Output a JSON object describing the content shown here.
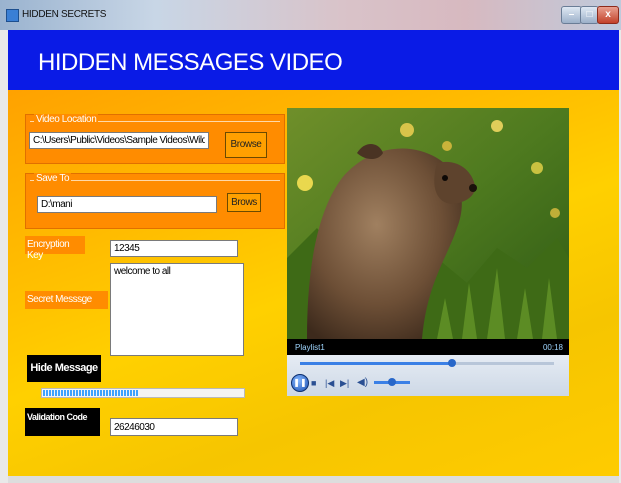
{
  "window": {
    "title": "HIDDEN SECRETS",
    "min_label": "–",
    "max_label": "□",
    "close_label": "x"
  },
  "header": {
    "title": "HIDDEN MESSAGES VIDEO"
  },
  "video_location": {
    "legend": "Video Location",
    "value": "C:\\Users\\Public\\Videos\\Sample Videos\\Wildlife",
    "browse_label": "Browse"
  },
  "save_to": {
    "legend": "Save To",
    "value": "D:\\mani",
    "browse_label": "Brows"
  },
  "encryption": {
    "label": "Encryption Key",
    "value": "12345"
  },
  "secret": {
    "label": "Secret Messsge",
    "value": "welcome to all"
  },
  "hide_button": {
    "label": "Hide Message"
  },
  "progress": {
    "fraction": 0.48
  },
  "validation": {
    "label": "Validation Code",
    "value": "26246030"
  },
  "player": {
    "playlist_label": "Playlist1",
    "time": "00:18",
    "seek_fraction": 0.6,
    "volume_fraction": 0.5,
    "icons": [
      "play-pause-icon",
      "stop-icon",
      "previous-icon",
      "next-icon",
      "volume-icon"
    ]
  },
  "colors": {
    "header_blue": "#0a1be6",
    "panel_orange": "#ff8c00",
    "background_yellow": "#ffd000"
  }
}
